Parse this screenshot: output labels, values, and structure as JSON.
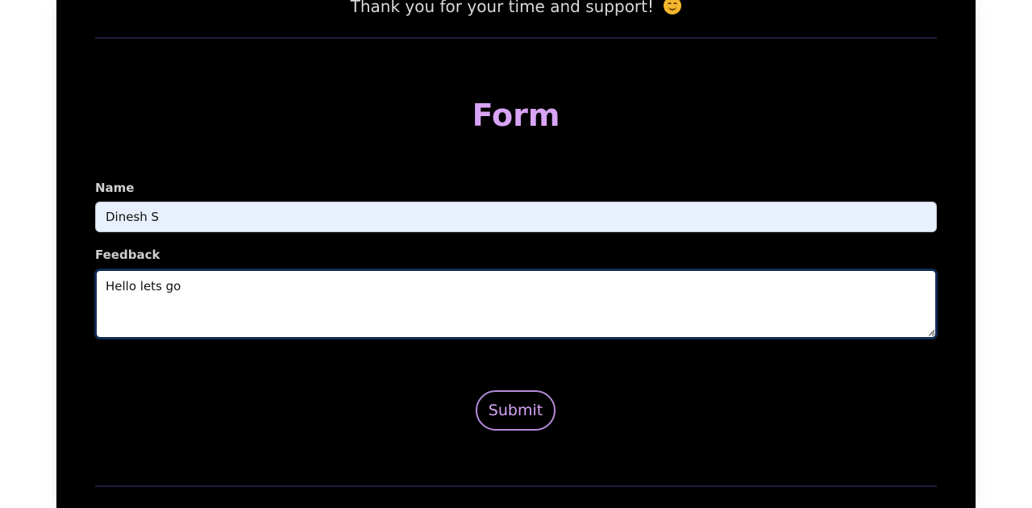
{
  "header": {
    "thanks_text": "Thank you for your time and support!",
    "emoji_icon": "smiling-face-icon"
  },
  "form": {
    "title": "Form",
    "name_label": "Name",
    "name_value": "Dinesh S",
    "feedback_label": "Feedback",
    "feedback_value": "Hello lets go",
    "submit_label": "Submit"
  },
  "colors": {
    "page_background": "#000000",
    "title_color": "#d8a4f5",
    "button_border": "#b48ad8",
    "input_fill": "#e8f0fe",
    "focus_border": "#0f2a55",
    "divider": "#231d3b"
  }
}
